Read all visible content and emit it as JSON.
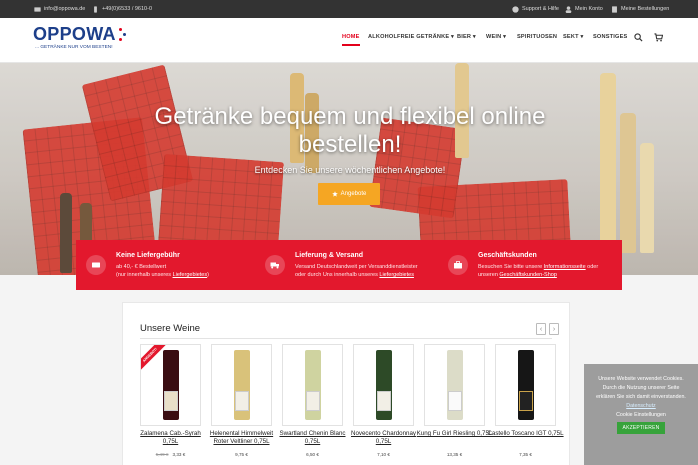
{
  "topbar": {
    "email": "info@oppowa.de",
    "phone": "+49(0)6533 / 9610-0",
    "support": "Support & Hilfe",
    "account": "Mein Konto",
    "orders": "Meine Bestellungen"
  },
  "logo": {
    "brand": "OPPOWA",
    "tagline": "... GETRÄNKE NUR VOM BESTEN!"
  },
  "nav": {
    "home": "HOME",
    "alkoholfrei": "ALKOHOLFREIE GETRÄNKE ▾",
    "bier": "BIER ▾",
    "wein": "WEIN ▾",
    "spirituosen": "SPIRITUOSEN",
    "sekt": "SEKT ▾",
    "sonstiges": "SONSTIGES",
    "icons": [
      "search-icon",
      "cart-icon"
    ]
  },
  "hero": {
    "title": "Getränke bequem und flexibel online bestellen!",
    "subtitle": "Entdecken Sie unsere wöchentlichen Angebote!",
    "button": "Angebote",
    "button_color": "#f5a623"
  },
  "info": {
    "band_color": "#e3182d",
    "col1": {
      "title": "Keine Liefergebühr",
      "line1": "ab 40,- € Bestellwert",
      "line2_prefix": "(nur innerhalb unseres ",
      "line2_link": "Liefergebietes",
      "line2_suffix": ")",
      "icon": "money-icon"
    },
    "col2": {
      "title": "Lieferung & Versand",
      "line1": "Versand Deutschlandweit per Versanddienstleister",
      "line2_prefix": "oder durch Uns innerhalb unseres ",
      "line2_link": "Liefergebietes",
      "icon": "truck-icon"
    },
    "col3": {
      "title": "Geschäftskunden",
      "line1_prefix": "Besuchen Sie bitte unsere ",
      "line1_link": "Informationsseite",
      "line1_suffix": " oder",
      "line2_prefix": "unseren ",
      "line2_link": "Geschäftskunden-Shop",
      "icon": "briefcase-icon"
    }
  },
  "wines": {
    "title": "Unsere Weine",
    "products": [
      {
        "name": "Zalamena Cab.-Syrah 0,75L",
        "old_price": "5,49 €",
        "price": "3,33 €",
        "sale_badge": "ANGEBOT!"
      },
      {
        "name": "Helenental Himmelweit Roter Veltliner 0,75L",
        "price": "9,75 €"
      },
      {
        "name": "Swartland Chenin Blanc 0,75L",
        "price": "6,50 €"
      },
      {
        "name": "Novecento Chardonnay 0,75L",
        "price": "7,10 €"
      },
      {
        "name": "Kung Fu Girl Riesling 0,75L",
        "price": "13,35 €"
      },
      {
        "name": "Castello Toscano IGT 0,75L",
        "price": "7,35 €"
      }
    ]
  },
  "cookie": {
    "line1": "Unsere Website verwendet Cookies.",
    "line2": "Durch die Nutzung unserer Seite",
    "line3": "erklären Sie sich damit einverstanden.",
    "link": "Datenschutz",
    "settings": "Cookie Einstellungen",
    "accept": "AKZEPTIEREN"
  }
}
